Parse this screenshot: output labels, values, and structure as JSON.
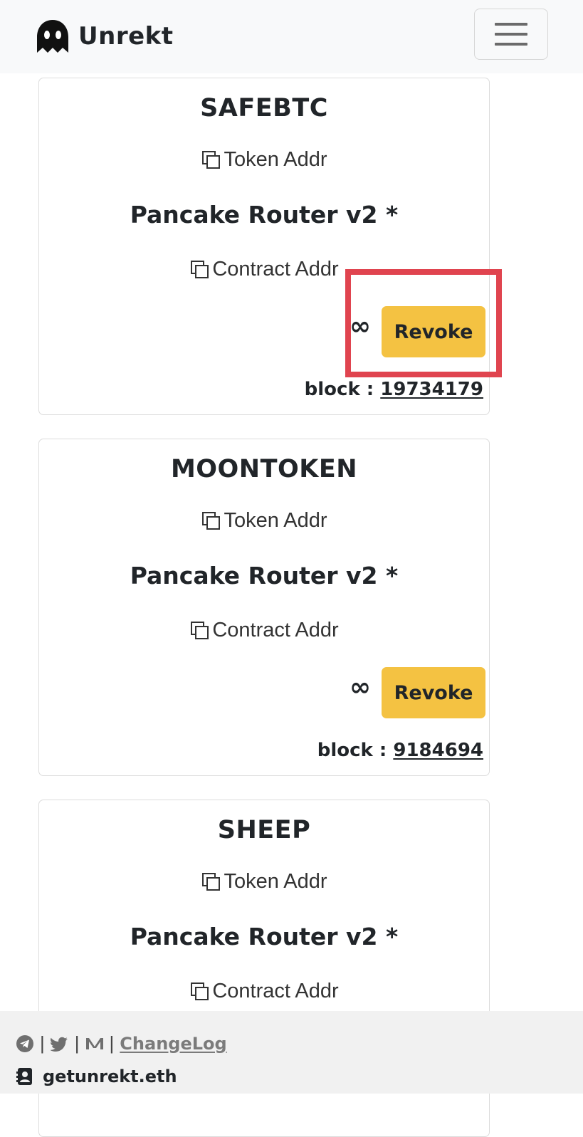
{
  "navbar": {
    "brand_name": "Unrekt",
    "logo_icon": "ghost-icon",
    "menu_icon": "hamburger-icon"
  },
  "cards": [
    {
      "token_name": "SAFEBTC",
      "token_addr_label": "Token Addr",
      "spender_name": "Pancake Router v2 *",
      "contract_addr_label": "Contract Addr",
      "allowance": "∞",
      "revoke_label": "Revoke",
      "block_label": "block :",
      "block_number": "19734179"
    },
    {
      "token_name": "MOONTOKEN",
      "token_addr_label": "Token Addr",
      "spender_name": "Pancake Router v2 *",
      "contract_addr_label": "Contract Addr",
      "allowance": "∞",
      "revoke_label": "Revoke",
      "block_label": "block :",
      "block_number": "9184694"
    },
    {
      "token_name": "SHEEP",
      "token_addr_label": "Token Addr",
      "spender_name": "Pancake Router v2 *",
      "contract_addr_label": "Contract Addr"
    }
  ],
  "footer": {
    "separator": "|",
    "changelog_label": "ChangeLog",
    "ens_name": "getunrekt.eth"
  },
  "colors": {
    "revoke_button": "#f4c242",
    "highlight_box": "#e0444f",
    "navbar_bg": "#f8f9fa",
    "footer_bg": "#f1f1f1"
  }
}
